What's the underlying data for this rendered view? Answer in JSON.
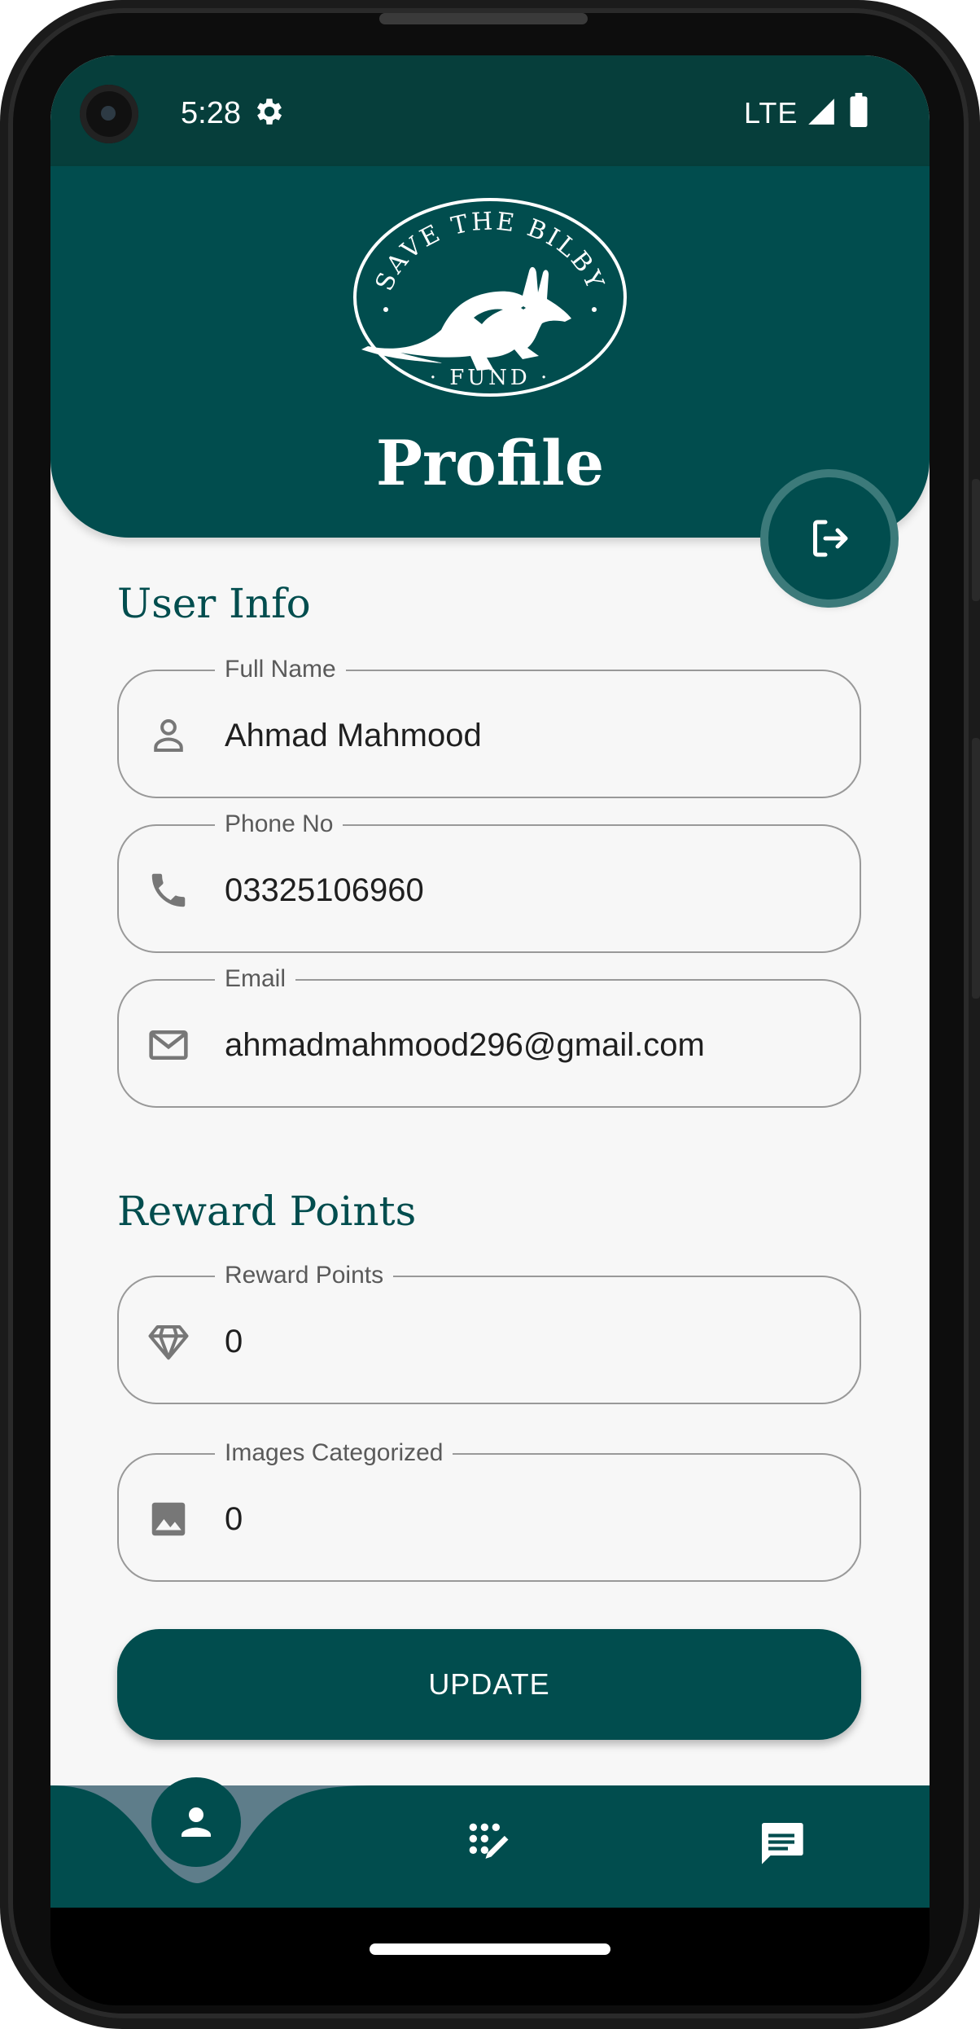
{
  "status_bar": {
    "time": "5:28",
    "network": "LTE",
    "icons": [
      "gear-icon",
      "signal-icon",
      "battery-icon"
    ]
  },
  "header": {
    "logo_text_top": "SAVE THE BILBY",
    "logo_text_bottom": "FUND",
    "title": "Profile"
  },
  "user_info": {
    "section_title": "User Info",
    "fields": [
      {
        "label": "Full Name",
        "value": "Ahmad Mahmood",
        "icon": "person-icon"
      },
      {
        "label": "Phone No",
        "value": "03325106960",
        "icon": "phone-icon"
      },
      {
        "label": "Email",
        "value": "ahmadmahmood296@gmail.com",
        "icon": "email-icon"
      }
    ]
  },
  "reward_points": {
    "section_title": "Reward Points",
    "fields": [
      {
        "label": "Reward Points",
        "value": "0",
        "icon": "diamond-icon"
      },
      {
        "label": "Images Categorized",
        "value": "0",
        "icon": "image-icon"
      }
    ]
  },
  "update_button": "UPDATE",
  "bottom_nav": {
    "items": [
      {
        "name": "profile",
        "icon": "person-icon",
        "active": true
      },
      {
        "name": "categorize",
        "icon": "magic-grid-icon",
        "active": false
      },
      {
        "name": "messages",
        "icon": "chat-icon",
        "active": false
      }
    ]
  },
  "colors": {
    "primary": "#014d4e",
    "status_bar": "#063e3b",
    "background": "#f7f7f7",
    "outline": "#999999",
    "accent_ring": "#3c7a7a"
  }
}
